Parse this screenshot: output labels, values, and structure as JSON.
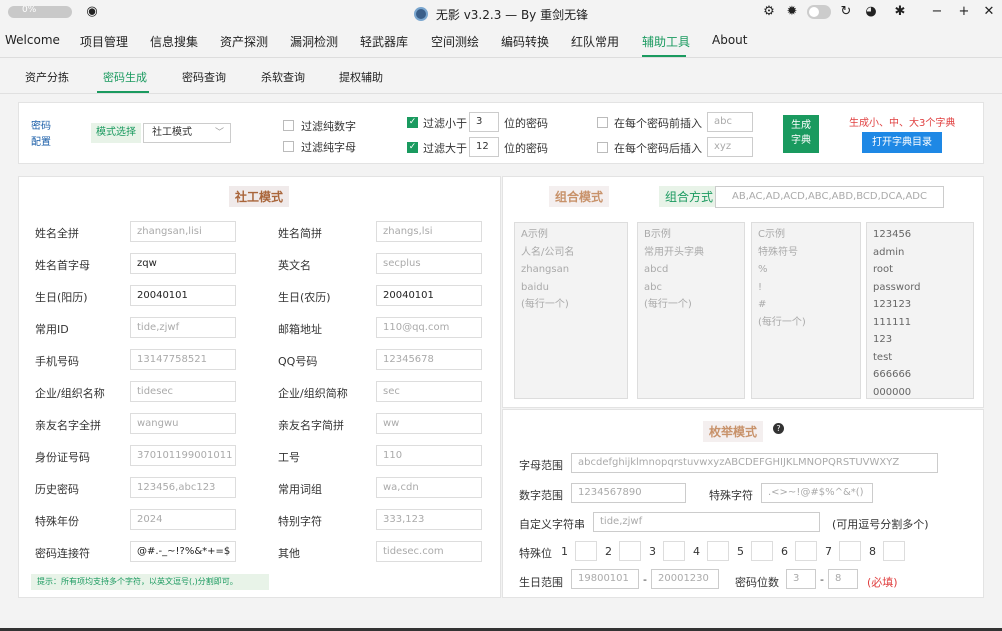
{
  "titlebar": {
    "progress_text": "0%",
    "progress_value": 0,
    "title": "无影 v3.2.3 — By 重剑无锋",
    "icons": [
      "settings-icon",
      "bug-icon",
      "theme-toggle",
      "refresh-icon",
      "github-icon",
      "pin-icon",
      "minimize-icon",
      "maximize-icon",
      "close-icon"
    ]
  },
  "menu": {
    "items": [
      "Welcome",
      "项目管理",
      "信息搜集",
      "资产探测",
      "漏洞检测",
      "轻武器库",
      "空间测绘",
      "编码转换",
      "红队常用",
      "辅助工具",
      "About"
    ],
    "active": "辅助工具"
  },
  "subtabs": {
    "items": [
      "资产分拣",
      "密码生成",
      "密码查询",
      "杀软查询",
      "提权辅助"
    ],
    "active": "密码生成"
  },
  "config": {
    "label_line1": "密码",
    "label_line2": "配置",
    "mode_label": "模式选择",
    "mode_value": "社工模式",
    "filter_digits": "过滤纯数字",
    "filter_letters": "过滤纯字母",
    "filter_lt": "过滤小于",
    "filter_lt_value": "3",
    "filter_gt": "过滤大于",
    "filter_gt_value": "12",
    "pw_suffix": "位的密码",
    "prefix_insert": "在每个密码前插入",
    "prefix_placeholder": "abc",
    "suffix_insert": "在每个密码后插入",
    "suffix_placeholder": "xyz",
    "gen_line1": "生成",
    "gen_line2": "字典",
    "red_note": "生成小、中、大3个字典",
    "open_dir": "打开字典目录"
  },
  "social": {
    "title": "社工模式",
    "fields": [
      {
        "label": "姓名全拼",
        "value": "zhangsan,lisi",
        "filled": false
      },
      {
        "label": "姓名简拼",
        "value": "zhangs,lsi",
        "filled": false
      },
      {
        "label": "姓名首字母",
        "value": "zqw",
        "filled": true
      },
      {
        "label": "英文名",
        "value": "secplus",
        "filled": false
      },
      {
        "label": "生日(阳历)",
        "value": "20040101",
        "filled": true
      },
      {
        "label": "生日(农历)",
        "value": "20040101",
        "filled": true
      },
      {
        "label": "常用ID",
        "value": "tide,zjwf",
        "filled": false
      },
      {
        "label": "邮箱地址",
        "value": "110@qq.com",
        "filled": false
      },
      {
        "label": "手机号码",
        "value": "13147758521",
        "filled": false
      },
      {
        "label": "QQ号码",
        "value": "12345678",
        "filled": false
      },
      {
        "label": "企业/组织名称",
        "value": "tidesec",
        "filled": false
      },
      {
        "label": "企业/组织简称",
        "value": "sec",
        "filled": false
      },
      {
        "label": "亲友名字全拼",
        "value": "wangwu",
        "filled": false
      },
      {
        "label": "亲友名字简拼",
        "value": "ww",
        "filled": false
      },
      {
        "label": "身份证号码",
        "value": "370101199001011",
        "filled": false
      },
      {
        "label": "工号",
        "value": "110",
        "filled": false
      },
      {
        "label": "历史密码",
        "value": "123456,abc123",
        "filled": false
      },
      {
        "label": "常用词组",
        "value": "wa,cdn",
        "filled": false
      },
      {
        "label": "特殊年份",
        "value": "2024",
        "filled": false
      },
      {
        "label": "特别字符",
        "value": "333,123",
        "filled": false
      },
      {
        "label": "密码连接符",
        "value": "@#.-_~!?%&*+=$",
        "filled": true
      },
      {
        "label": "其他",
        "value": "tidesec.com",
        "filled": false
      }
    ],
    "hint": "提示：所有项均支持多个字符，以英文逗号(,)分割即可。"
  },
  "combo": {
    "title": "组合模式",
    "method_label": "组合方式",
    "method_placeholder": "AB,AC,AD,ACD,ABC,ABD,BCD,DCA,ADC",
    "box_a": [
      "A示例",
      "人名/公司名",
      "zhangsan",
      "baidu",
      "(每行一个)"
    ],
    "box_b": [
      "B示例",
      "常用开头字典",
      "abcd",
      "abc",
      "(每行一个)"
    ],
    "box_c": [
      "C示例",
      "特殊符号",
      "%",
      "!",
      "#",
      "(每行一个)"
    ],
    "box_d": [
      "123456",
      "admin",
      "root",
      "password",
      "123123",
      "111111",
      "123",
      "test",
      "666666",
      "000000"
    ]
  },
  "enum": {
    "title": "枚举模式",
    "help_icon": "help-icon",
    "letter_label": "字母范围",
    "letter_value": "abcdefghijklmnopqrstuvwxyzABCDEFGHIJKLMNOPQRSTUVWXYZ",
    "digit_label": "数字范围",
    "digit_value": "1234567890",
    "special_label": "特殊字符",
    "special_value": ".<>~!@#$%^&*()",
    "custom_label": "自定义字符串",
    "custom_placeholder": "tide,zjwf",
    "custom_note": "(可用逗号分割多个)",
    "special_pos_label": "特殊位",
    "positions": [
      "1",
      "2",
      "3",
      "4",
      "5",
      "6",
      "7",
      "8"
    ],
    "birth_label": "生日范围",
    "birth_from": "19800101",
    "birth_to": "20001230",
    "dash": "-",
    "len_label": "密码位数",
    "len_from": "3",
    "len_to": "8",
    "required": "(必填)"
  }
}
